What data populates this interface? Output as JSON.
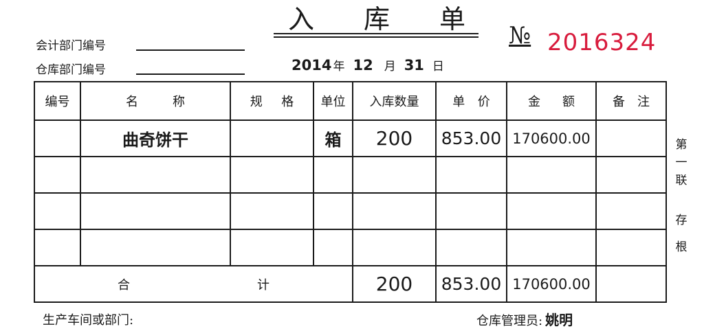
{
  "title": [
    "入",
    "库",
    "单"
  ],
  "serial": {
    "label": "№",
    "value": "2016324"
  },
  "meta": {
    "accounting_dept_label": "会计部门编号",
    "warehouse_dept_label": "仓库部门编号"
  },
  "date": {
    "year": "2014",
    "year_unit": "年",
    "month": "12",
    "month_unit": "月",
    "day": "31",
    "day_unit": "日"
  },
  "table": {
    "headers": {
      "no": "编号",
      "name": [
        "名",
        "称"
      ],
      "spec": [
        "规",
        "格"
      ],
      "unit": "单位",
      "qty": "入库数量",
      "price": [
        "单",
        "价"
      ],
      "amount": [
        "金",
        "额"
      ],
      "remark": [
        "备",
        "注"
      ]
    },
    "rows": [
      {
        "no": "",
        "name": "曲奇饼干",
        "spec": "",
        "unit": "箱",
        "qty": "200",
        "price": "853.00",
        "amount": "170600.00",
        "remark": ""
      },
      {
        "no": "",
        "name": "",
        "spec": "",
        "unit": "",
        "qty": "",
        "price": "",
        "amount": "",
        "remark": ""
      },
      {
        "no": "",
        "name": "",
        "spec": "",
        "unit": "",
        "qty": "",
        "price": "",
        "amount": "",
        "remark": ""
      },
      {
        "no": "",
        "name": "",
        "spec": "",
        "unit": "",
        "qty": "",
        "price": "",
        "amount": "",
        "remark": ""
      }
    ],
    "total": {
      "label": [
        "合",
        "计"
      ],
      "qty": "200",
      "price": "853.00",
      "amount": "170600.00"
    }
  },
  "side_note": {
    "copy": [
      "第",
      "一",
      "联"
    ],
    "stub": [
      "存",
      "根"
    ]
  },
  "footer": {
    "production_dept_label": "生产车间或部门:",
    "keeper_label": "仓库管理员:",
    "keeper_name": "姚明"
  }
}
